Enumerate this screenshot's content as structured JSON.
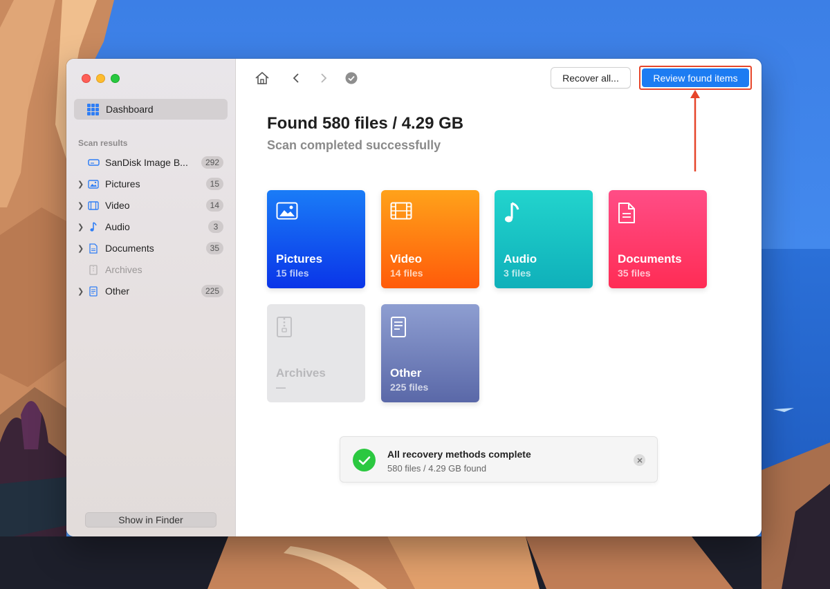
{
  "window": {
    "sidebar": {
      "dashboard_label": "Dashboard",
      "section_label": "Scan results",
      "items": [
        {
          "label": "SanDisk Image B...",
          "count": "292",
          "icon": "drive-icon",
          "expandable": false
        },
        {
          "label": "Pictures",
          "count": "15",
          "icon": "image-icon",
          "expandable": true
        },
        {
          "label": "Video",
          "count": "14",
          "icon": "film-icon",
          "expandable": true
        },
        {
          "label": "Audio",
          "count": "3",
          "icon": "music-note-icon",
          "expandable": true
        },
        {
          "label": "Documents",
          "count": "35",
          "icon": "document-icon",
          "expandable": true
        },
        {
          "label": "Archives",
          "count": "",
          "icon": "archive-icon",
          "expandable": false,
          "disabled": true
        },
        {
          "label": "Other",
          "count": "225",
          "icon": "file-icon",
          "expandable": true
        }
      ],
      "show_in_finder": "Show in Finder"
    },
    "toolbar": {
      "recover_all": "Recover all...",
      "review_found_items": "Review found items"
    },
    "main": {
      "title": "Found 580 files / 4.29 GB",
      "subtitle": "Scan completed successfully",
      "tiles": [
        {
          "name": "Pictures",
          "count": "15 files"
        },
        {
          "name": "Video",
          "count": "14 files"
        },
        {
          "name": "Audio",
          "count": "3 files"
        },
        {
          "name": "Documents",
          "count": "35 files"
        },
        {
          "name": "Archives",
          "count": "—"
        },
        {
          "name": "Other",
          "count": "225 files"
        }
      ]
    },
    "notice": {
      "title": "All recovery methods complete",
      "subtitle": "580 files / 4.29 GB found"
    }
  },
  "colors": {
    "accent_blue": "#1d7cf2",
    "annotation_red": "#e6452a",
    "success_green": "#2bc840"
  }
}
